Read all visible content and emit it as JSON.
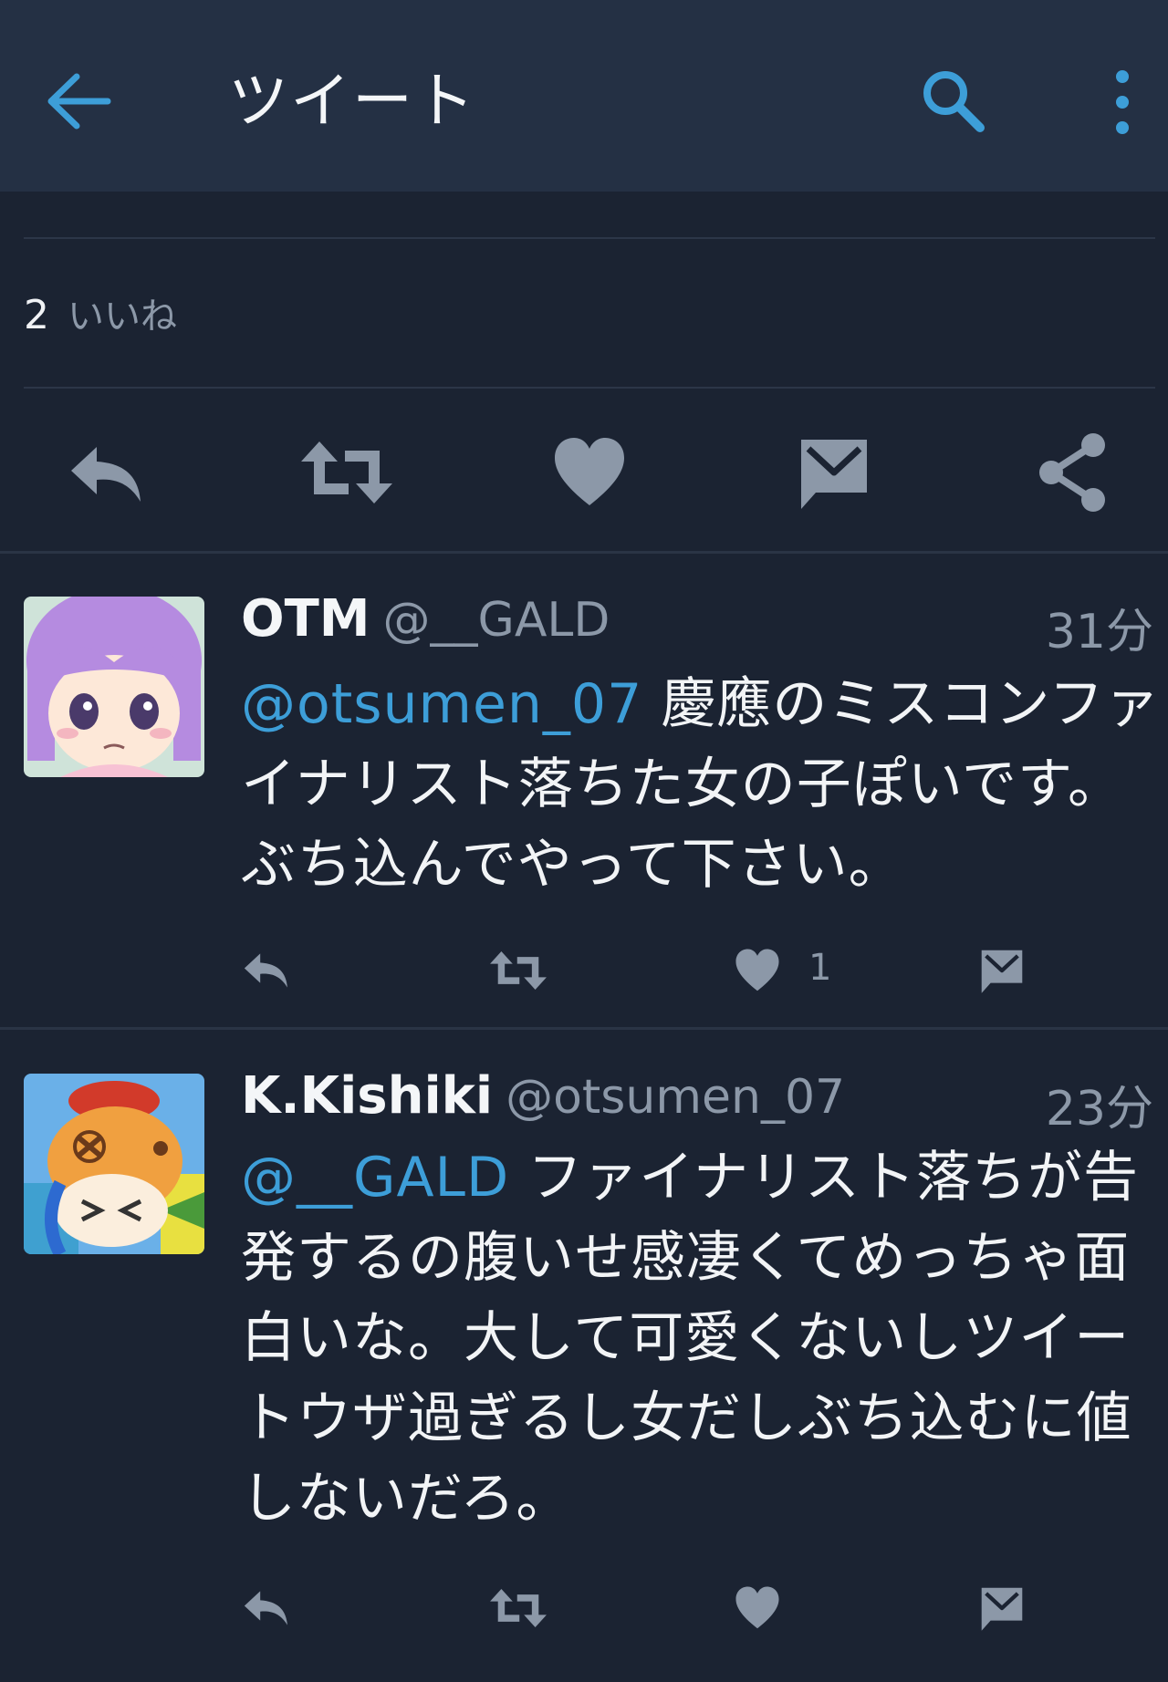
{
  "appbar": {
    "title": "ツイート"
  },
  "stats": {
    "likes_count": "2",
    "likes_label": "いいね"
  },
  "tweets": [
    {
      "name": "OTM",
      "handle": "@__GALD",
      "time": "31分",
      "mention": "@otsumen_07",
      "text": " 慶應のミスコンファイナリスト落ちた女の子ぽいです。ぶち込んでやって下さい。",
      "like_count": "1"
    },
    {
      "name": "K.Kishiki",
      "handle": "@otsumen_07",
      "time": "23分",
      "mention": "@__GALD",
      "text": " ファイナリスト落ちが告発するの腹いせ感凄くてめっちゃ面白いな。大して可愛くないしツイートウザ過ぎるし女だしぶち込むに値しないだろ。"
    }
  ],
  "colors": {
    "accent": "#3d9ed8",
    "icon": "#8c98a8",
    "background": "#1b2332",
    "appbar": "#243044"
  },
  "icons": [
    "back-arrow-icon",
    "search-icon",
    "more-vert-icon",
    "reply-icon",
    "retweet-icon",
    "heart-icon",
    "dm-icon",
    "share-icon"
  ]
}
